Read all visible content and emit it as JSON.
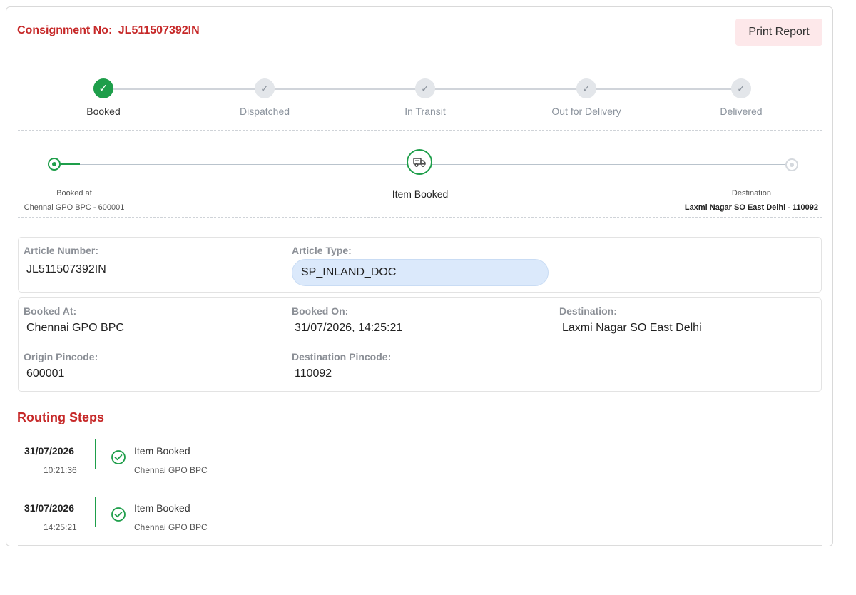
{
  "header": {
    "consignment_label": "Consignment No:",
    "consignment_number": "JL511507392IN",
    "print_label": "Print Report"
  },
  "stepper": {
    "steps": [
      {
        "label": "Booked",
        "done": true
      },
      {
        "label": "Dispatched",
        "done": false
      },
      {
        "label": "In Transit",
        "done": false
      },
      {
        "label": "Out for Delivery",
        "done": false
      },
      {
        "label": "Delivered",
        "done": false
      }
    ]
  },
  "route": {
    "origin_label": "Booked at",
    "origin_value": "Chennai GPO BPC - 600001",
    "current_status": "Item Booked",
    "destination_label": "Destination",
    "destination_value": "Laxmi Nagar SO East Delhi - 110092"
  },
  "article": {
    "number_label": "Article Number:",
    "number_value": "JL511507392IN",
    "type_label": "Article Type:",
    "type_value": "SP_INLAND_DOC"
  },
  "booking": {
    "booked_at_label": "Booked At:",
    "booked_at_value": "Chennai GPO BPC",
    "booked_on_label": "Booked On:",
    "booked_on_value": "31/07/2026, 14:25:21",
    "destination_label": "Destination:",
    "destination_value": "Laxmi Nagar SO East Delhi",
    "origin_pin_label": "Origin Pincode:",
    "origin_pin_value": "600001",
    "dest_pin_label": "Destination Pincode:",
    "dest_pin_value": "110092"
  },
  "routing": {
    "title": "Routing Steps",
    "steps": [
      {
        "date": "31/07/2026",
        "time": "10:21:36",
        "event": "Item Booked",
        "office": "Chennai GPO BPC"
      },
      {
        "date": "31/07/2026",
        "time": "14:25:21",
        "event": "Item Booked",
        "office": "Chennai GPO BPC"
      }
    ]
  },
  "colors": {
    "accent_red": "#c62828",
    "success_green": "#1e9e4a",
    "pill_blue": "#dbe9fb"
  },
  "icons": {
    "step_done": "check-icon",
    "step_pending": "check-icon",
    "current_location": "delivery-truck-icon",
    "routing_step": "check-circle-icon"
  }
}
